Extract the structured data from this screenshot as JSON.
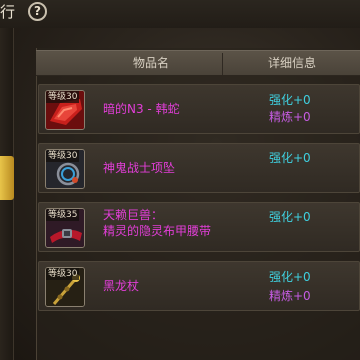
{
  "top": {
    "title": "行",
    "help_symbol": "?"
  },
  "table": {
    "col_name": "物品名",
    "col_detail": "详细信息"
  },
  "items": [
    {
      "level": "等级30",
      "name_line1": "暗的N3 - 韩蛇",
      "name_line2": "",
      "stat1": "强化+0",
      "stat2": "精炼+0",
      "icon": "red-armor-icon"
    },
    {
      "level": "等级30",
      "name_line1": "神鬼战士项坠",
      "name_line2": "",
      "stat1": "强化+0",
      "stat2": "",
      "icon": "necklace-icon"
    },
    {
      "level": "等级35",
      "name_line1": "天赖巨兽：",
      "name_line2": "精灵的隐灵布甲腰带",
      "stat1": "强化+0",
      "stat2": "",
      "icon": "belt-icon"
    },
    {
      "level": "等级30",
      "name_line1": "黑龙杖",
      "name_line2": "",
      "stat1": "强化+0",
      "stat2": "精炼+0",
      "icon": "staff-icon"
    }
  ],
  "colors": {
    "item_name": "#e23ed8",
    "enhance": "#3fd0e0",
    "refine": "#c55ce2",
    "tab_accent": "#e8c44a"
  }
}
